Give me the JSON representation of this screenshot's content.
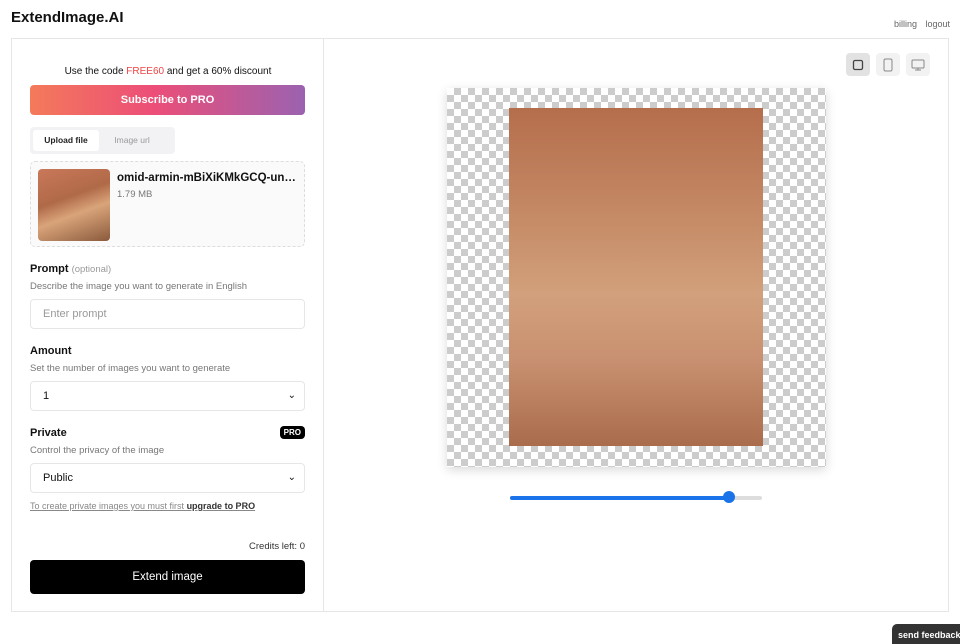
{
  "header": {
    "logo": "ExtendImage.AI",
    "billing": "billing",
    "logout": "logout"
  },
  "promo": {
    "prefix": "Use the code ",
    "code": "FREE60",
    "suffix": " and get a 60% discount",
    "subscribe": "Subscribe to PRO"
  },
  "tabs": [
    "Upload file",
    "Image url"
  ],
  "file": {
    "name": "omid-armin-mBiXiKMkGCQ-unsplash.jpg",
    "size": "1.79 MB"
  },
  "prompt": {
    "label": "Prompt",
    "optional": "(optional)",
    "desc": "Describe the image you want to generate in English",
    "placeholder": "Enter prompt"
  },
  "amount": {
    "label": "Amount",
    "desc": "Set the number of images you want to generate",
    "value": "1"
  },
  "private": {
    "label": "Private",
    "badge": "PRO",
    "desc": "Control the privacy of the image",
    "value": "Public",
    "note": "To create private images you must first ",
    "note_link": "upgrade to PRO"
  },
  "credits": "Credits left: 0",
  "extend": "Extend image",
  "slider": {
    "value_percent": 87
  },
  "feedback": "send feedback"
}
